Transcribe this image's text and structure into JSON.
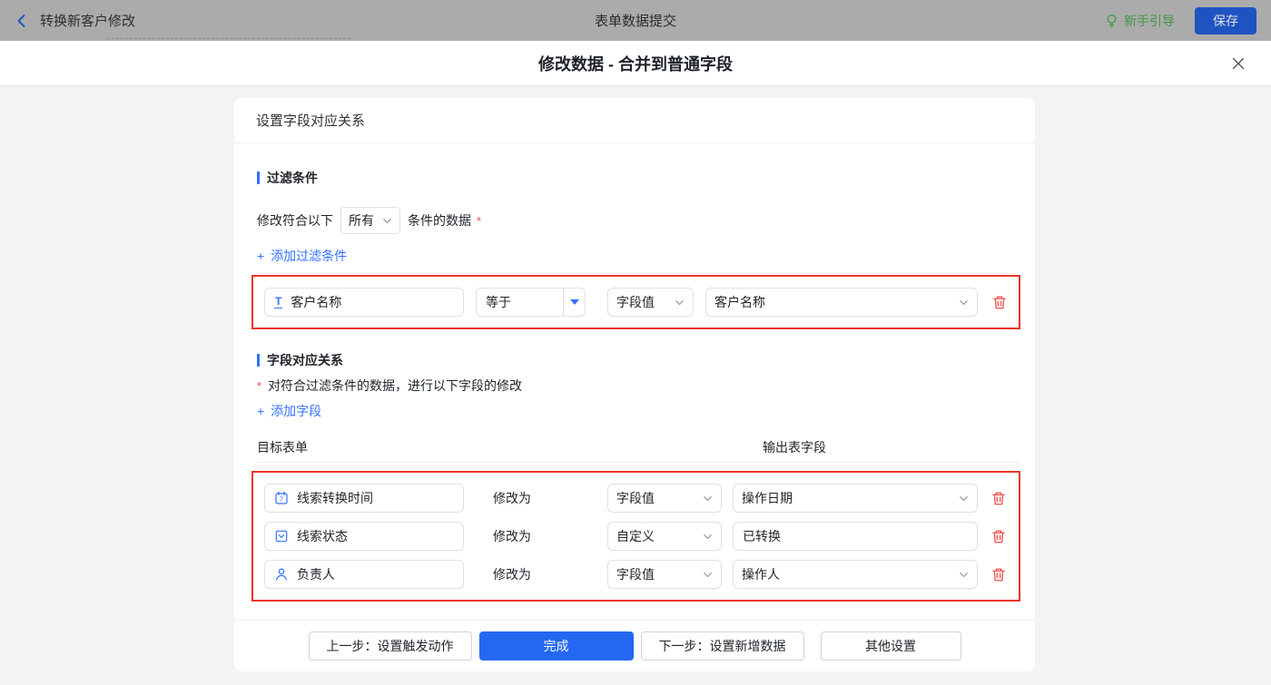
{
  "colors": {
    "accent_blue": "#3370ff",
    "primary_button_blue": "#2468f2",
    "danger_red": "#f54a45",
    "highlight_border_red": "#e8362b",
    "guide_green": "#3f9840",
    "topbar_gray": "#ababab",
    "page_bg": "#f2f3f5"
  },
  "topbar": {
    "back_label": "转换新客户修改",
    "title": "表单数据提交",
    "guide_label": "新手引导",
    "save_label": "保存"
  },
  "modal": {
    "title": "修改数据 - 合并到普通字段",
    "close_glyph": "✕"
  },
  "card": {
    "header": "设置字段对应关系",
    "plus": "+",
    "filter_section": {
      "title": "过滤条件",
      "match_prefix": "修改符合以下",
      "match_select_value": "所有",
      "match_suffix": "条件的数据",
      "required_mark": "*",
      "add_label": "添加过滤条件",
      "rows": [
        {
          "field": "客户名称",
          "field_icon": "text-field-icon",
          "operator": "等于",
          "value_type": "字段值",
          "value": "客户名称"
        }
      ]
    },
    "mapping_section": {
      "title": "字段对应关系",
      "required_mark": "*",
      "description": "对符合过滤条件的数据，进行以下字段的修改",
      "add_label": "添加字段",
      "col_target": "目标表单",
      "col_output": "输出表字段",
      "modify_label": "修改为",
      "rows": [
        {
          "field": "线索转换时间",
          "icon": "calendar-icon",
          "type": "字段值",
          "value": "操作日期"
        },
        {
          "field": "线索状态",
          "icon": "select-field-icon",
          "type": "自定义",
          "value": "已转换"
        },
        {
          "field": "负责人",
          "icon": "person-icon",
          "type": "字段值",
          "value": "操作人"
        }
      ]
    },
    "footer": {
      "prev_label": "上一步：设置触发动作",
      "done_label": "完成",
      "next_label": "下一步：设置新增数据",
      "other_label": "其他设置"
    }
  }
}
